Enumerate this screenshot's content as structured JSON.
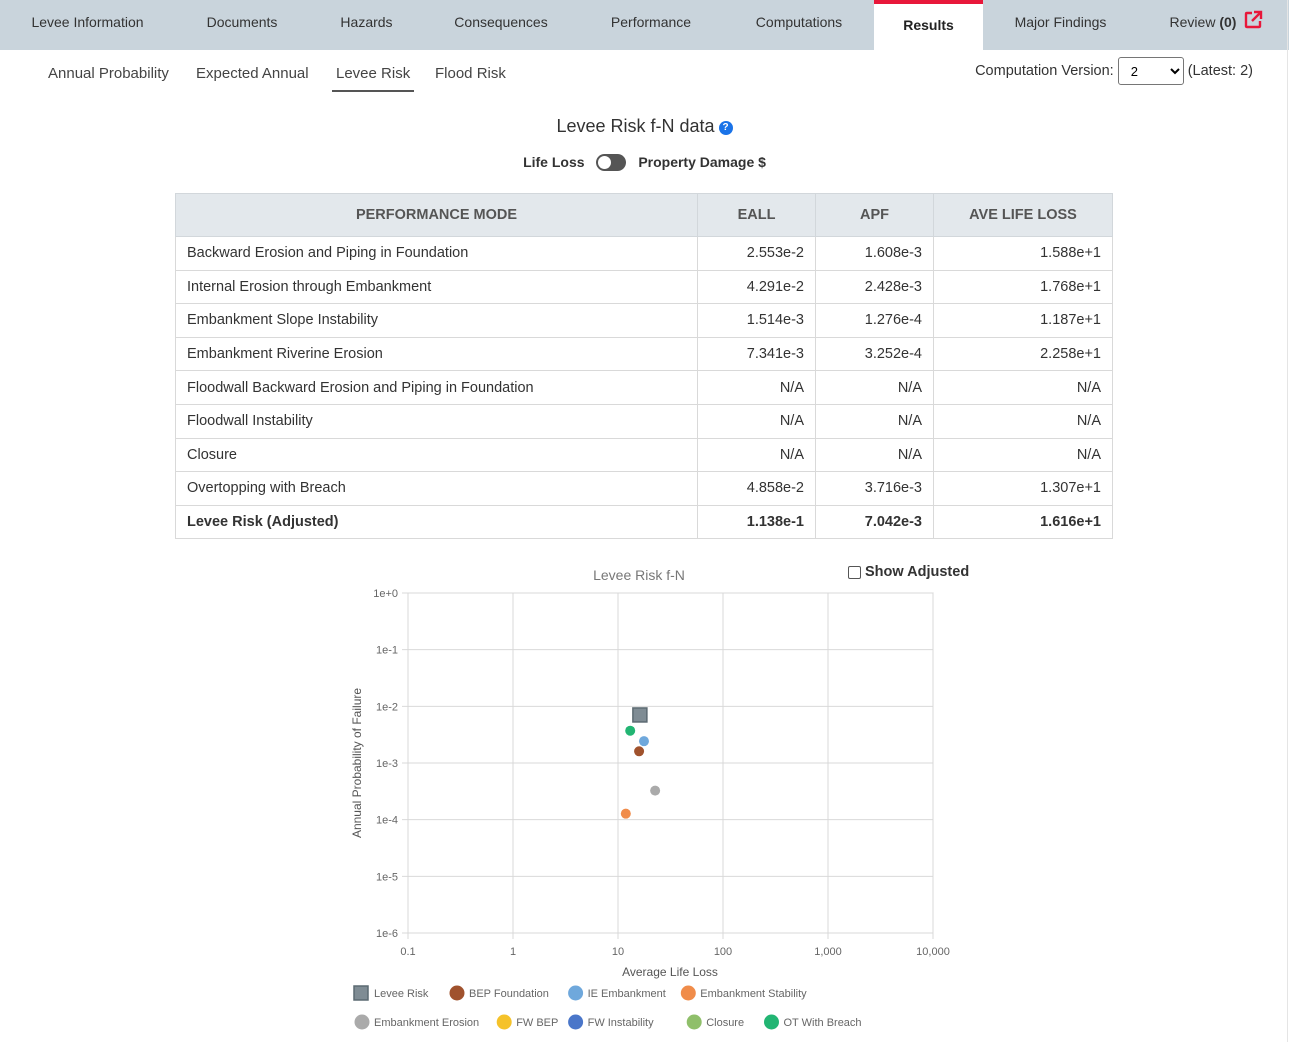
{
  "nav": {
    "tabs": [
      {
        "label": "Levee Information"
      },
      {
        "label": "Documents"
      },
      {
        "label": "Hazards"
      },
      {
        "label": "Consequences"
      },
      {
        "label": "Performance"
      },
      {
        "label": "Computations"
      },
      {
        "label": "Results"
      },
      {
        "label": "Major Findings"
      }
    ],
    "review_label": "Review",
    "review_count": "(0)",
    "active_color": "#e8173a"
  },
  "subtabs": [
    {
      "label": "Annual Probability"
    },
    {
      "label": "Expected Annual"
    },
    {
      "label": "Levee Risk"
    },
    {
      "label": "Flood Risk"
    }
  ],
  "computation": {
    "label": "Computation Version:",
    "selected": "2",
    "latest": "(Latest: 2)"
  },
  "title": "Levee Risk f-N data",
  "toggle": {
    "left_label": "Life Loss",
    "right_label": "Property Damage $"
  },
  "table": {
    "headers": [
      "PERFORMANCE MODE",
      "EALL",
      "APF",
      "AVE LIFE LOSS"
    ],
    "rows": [
      [
        "Backward Erosion and Piping in Foundation",
        "2.553e-2",
        "1.608e-3",
        "1.588e+1"
      ],
      [
        "Internal Erosion through Embankment",
        "4.291e-2",
        "2.428e-3",
        "1.768e+1"
      ],
      [
        "Embankment Slope Instability",
        "1.514e-3",
        "1.276e-4",
        "1.187e+1"
      ],
      [
        "Embankment Riverine Erosion",
        "7.341e-3",
        "3.252e-4",
        "2.258e+1"
      ],
      [
        "Floodwall Backward Erosion and Piping in Foundation",
        "N/A",
        "N/A",
        "N/A"
      ],
      [
        "Floodwall Instability",
        "N/A",
        "N/A",
        "N/A"
      ],
      [
        "Closure",
        "N/A",
        "N/A",
        "N/A"
      ],
      [
        "Overtopping with Breach",
        "4.858e-2",
        "3.716e-3",
        "1.307e+1"
      ]
    ],
    "total": [
      "Levee Risk (Adjusted)",
      "1.138e-1",
      "7.042e-3",
      "1.616e+1"
    ]
  },
  "show_adjusted_label": "Show Adjusted",
  "chart_data": {
    "type": "scatter",
    "title": "Levee Risk f-N",
    "xlabel": "Average Life Loss",
    "ylabel": "Annual Probability of Failure",
    "xscale": "log",
    "yscale": "log",
    "xlim": [
      0.1,
      10000
    ],
    "ylim": [
      1e-06,
      1
    ],
    "x_ticks": [
      "0.1",
      "1",
      "10",
      "100",
      "1,000",
      "10,000"
    ],
    "y_ticks": [
      "1e+0",
      "1e-1",
      "1e-2",
      "1e-3",
      "1e-4",
      "1e-5",
      "1e-6"
    ],
    "grid": true,
    "legend_position": "bottom",
    "series": [
      {
        "name": "Levee Risk",
        "marker": "square",
        "color": "#7f8c94",
        "points": [
          [
            16.16,
            0.007042
          ]
        ]
      },
      {
        "name": "BEP Foundation",
        "marker": "circle",
        "color": "#a0522d",
        "points": [
          [
            15.88,
            0.001608
          ]
        ]
      },
      {
        "name": "IE Embankment",
        "marker": "circle",
        "color": "#6fa8dc",
        "points": [
          [
            17.68,
            0.002428
          ]
        ]
      },
      {
        "name": "Embankment Stability",
        "marker": "circle",
        "color": "#f08c4a",
        "points": [
          [
            11.87,
            0.0001276
          ]
        ]
      },
      {
        "name": "Embankment Erosion",
        "marker": "circle",
        "color": "#aaaaaa",
        "points": [
          [
            22.58,
            0.0003252
          ]
        ]
      },
      {
        "name": "FW BEP",
        "marker": "circle",
        "color": "#f5c22a",
        "points": []
      },
      {
        "name": "FW Instability",
        "marker": "circle",
        "color": "#4a76c9",
        "points": []
      },
      {
        "name": "Closure",
        "marker": "circle",
        "color": "#8fbf6a",
        "points": []
      },
      {
        "name": "OT With Breach",
        "marker": "circle",
        "color": "#22b573",
        "points": [
          [
            13.07,
            0.003716
          ]
        ]
      }
    ]
  }
}
